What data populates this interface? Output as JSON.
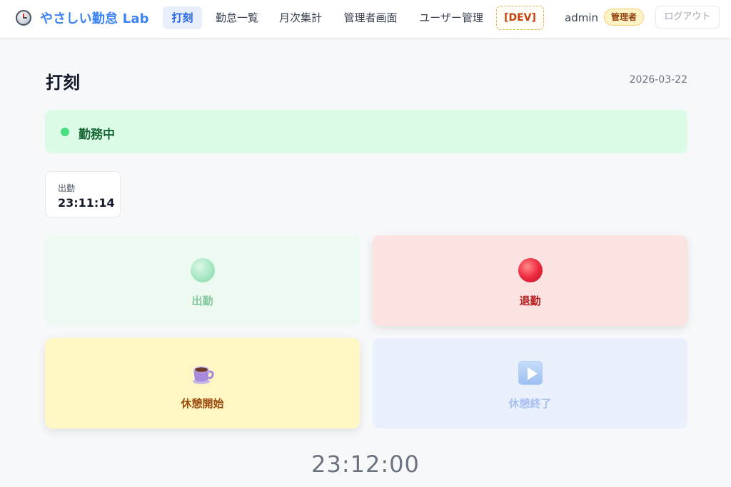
{
  "app": {
    "title": "やさしい勤怠 Lab",
    "brand_icon": "stopwatch-icon"
  },
  "nav": {
    "items": [
      {
        "label": "打刻",
        "active": true
      },
      {
        "label": "勤怠一覧",
        "active": false
      },
      {
        "label": "月次集計",
        "active": false
      },
      {
        "label": "管理者画面",
        "active": false
      },
      {
        "label": "ユーザー管理",
        "active": false
      }
    ],
    "dev_label": "[DEV]",
    "user_name": "admin",
    "role_badge": "管理者",
    "logout_label": "ログアウト"
  },
  "page": {
    "title": "打刻",
    "date": "2026-03-22"
  },
  "status": {
    "label": "勤務中",
    "color": "#4ade80"
  },
  "clock_in_card": {
    "label": "出勤",
    "time": "23:11:14"
  },
  "actions": [
    {
      "label": "出勤",
      "icon": "green-circle-icon",
      "enabled": false
    },
    {
      "label": "退勤",
      "icon": "red-circle-icon",
      "enabled": true
    },
    {
      "label": "休憩開始",
      "icon": "coffee-cup-icon",
      "enabled": true
    },
    {
      "label": "休憩終了",
      "icon": "play-button-icon",
      "enabled": false
    }
  ],
  "current_time": "23:12:00",
  "colors": {
    "brand": "#3b82f6",
    "status_bg": "#dcfce7",
    "clock_out_bg": "#fde2e2",
    "break_bg": "#fef7c4"
  }
}
